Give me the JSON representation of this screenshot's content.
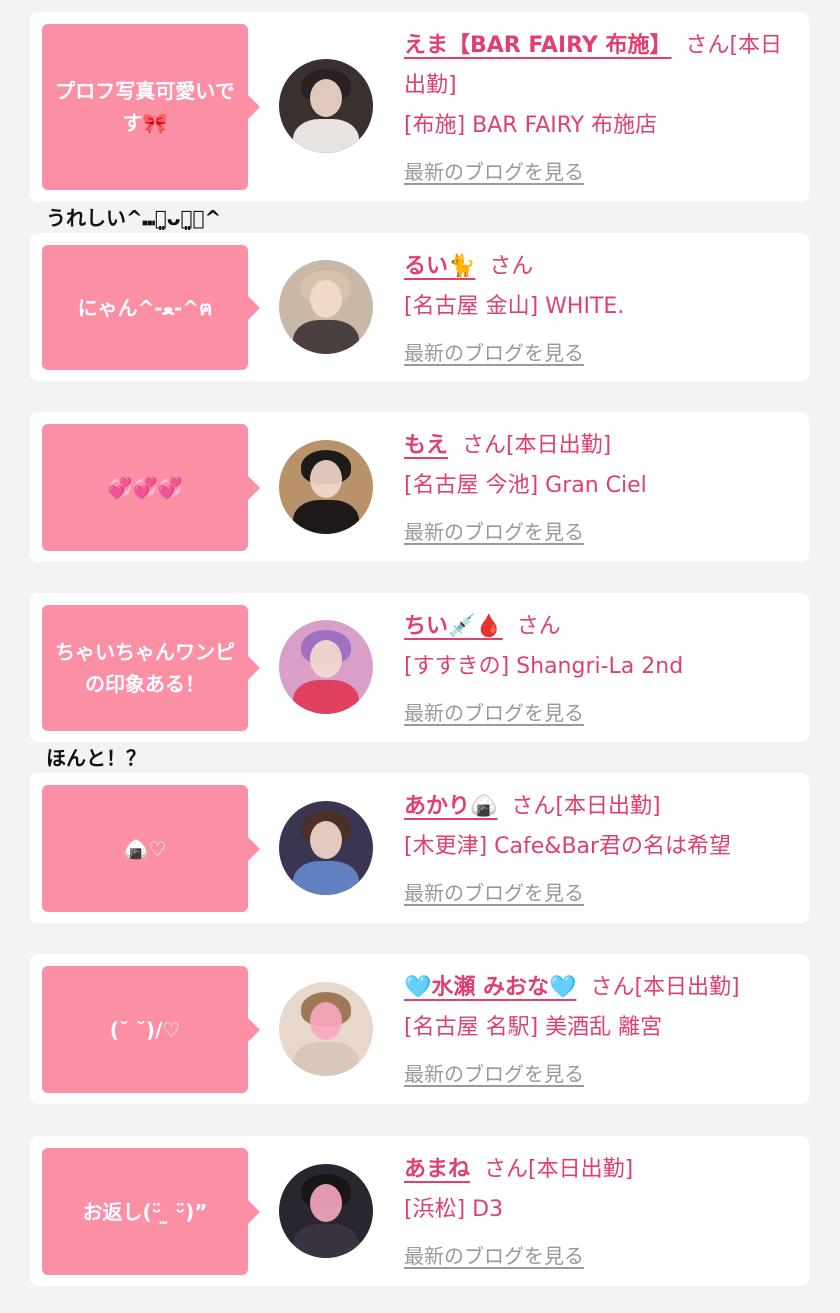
{
  "cards": [
    {
      "bubble_text": "プロフ写真可愛いです🎀",
      "name": "えま【BAR FAIRY 布施】",
      "suffix": "さん[本日出勤]",
      "shop": "[布施] BAR FAIRY 布施店",
      "blog_link": "最新のブログを見る",
      "reply": "うれしい^⑉・͈ᴗ・͈⑉^"
    },
    {
      "bubble_text": "にゃん^-ﻌ-^ฅ",
      "name": "るい🐈",
      "suffix": "さん",
      "shop": "[名古屋 金山] WHITE.",
      "blog_link": "最新のブログを見る"
    },
    {
      "bubble_text": "💞💞💞",
      "name": "もえ",
      "suffix": "さん[本日出勤]",
      "shop": "[名古屋 今池] Gran Ciel",
      "blog_link": "最新のブログを見る"
    },
    {
      "bubble_text": "ちゃいちゃんワンピの印象ある！",
      "name": "ちい💉🩸",
      "suffix": "さん",
      "shop": "[すすきの] Shangri-La 2nd",
      "blog_link": "最新のブログを見る",
      "reply": "ほんと！？"
    },
    {
      "bubble_text": "🍙♡",
      "name": "あかり🍙",
      "suffix": "さん[本日出勤]",
      "shop": "[木更津] Cafe&Bar君の名は希望",
      "blog_link": "最新のブログを見る"
    },
    {
      "bubble_text": "(˘ ˘)/♡",
      "name": "🩵水瀬 みおな🩵",
      "suffix": "さん[本日出勤]",
      "shop": "[名古屋 名駅] 美酒乱 離宮",
      "blog_link": "最新のブログを見る"
    },
    {
      "bubble_text": "お返し(ᵕ̈ ̫ ᵕ̈)”",
      "name": "あまね",
      "suffix": "さん[本日出勤]",
      "shop": "[浜松] D3",
      "blog_link": "最新のブログを見る"
    }
  ],
  "colors": {
    "bubble": "#fb8fa6",
    "name": "#e0406e",
    "link": "#999999",
    "background": "#f3f3f3"
  }
}
